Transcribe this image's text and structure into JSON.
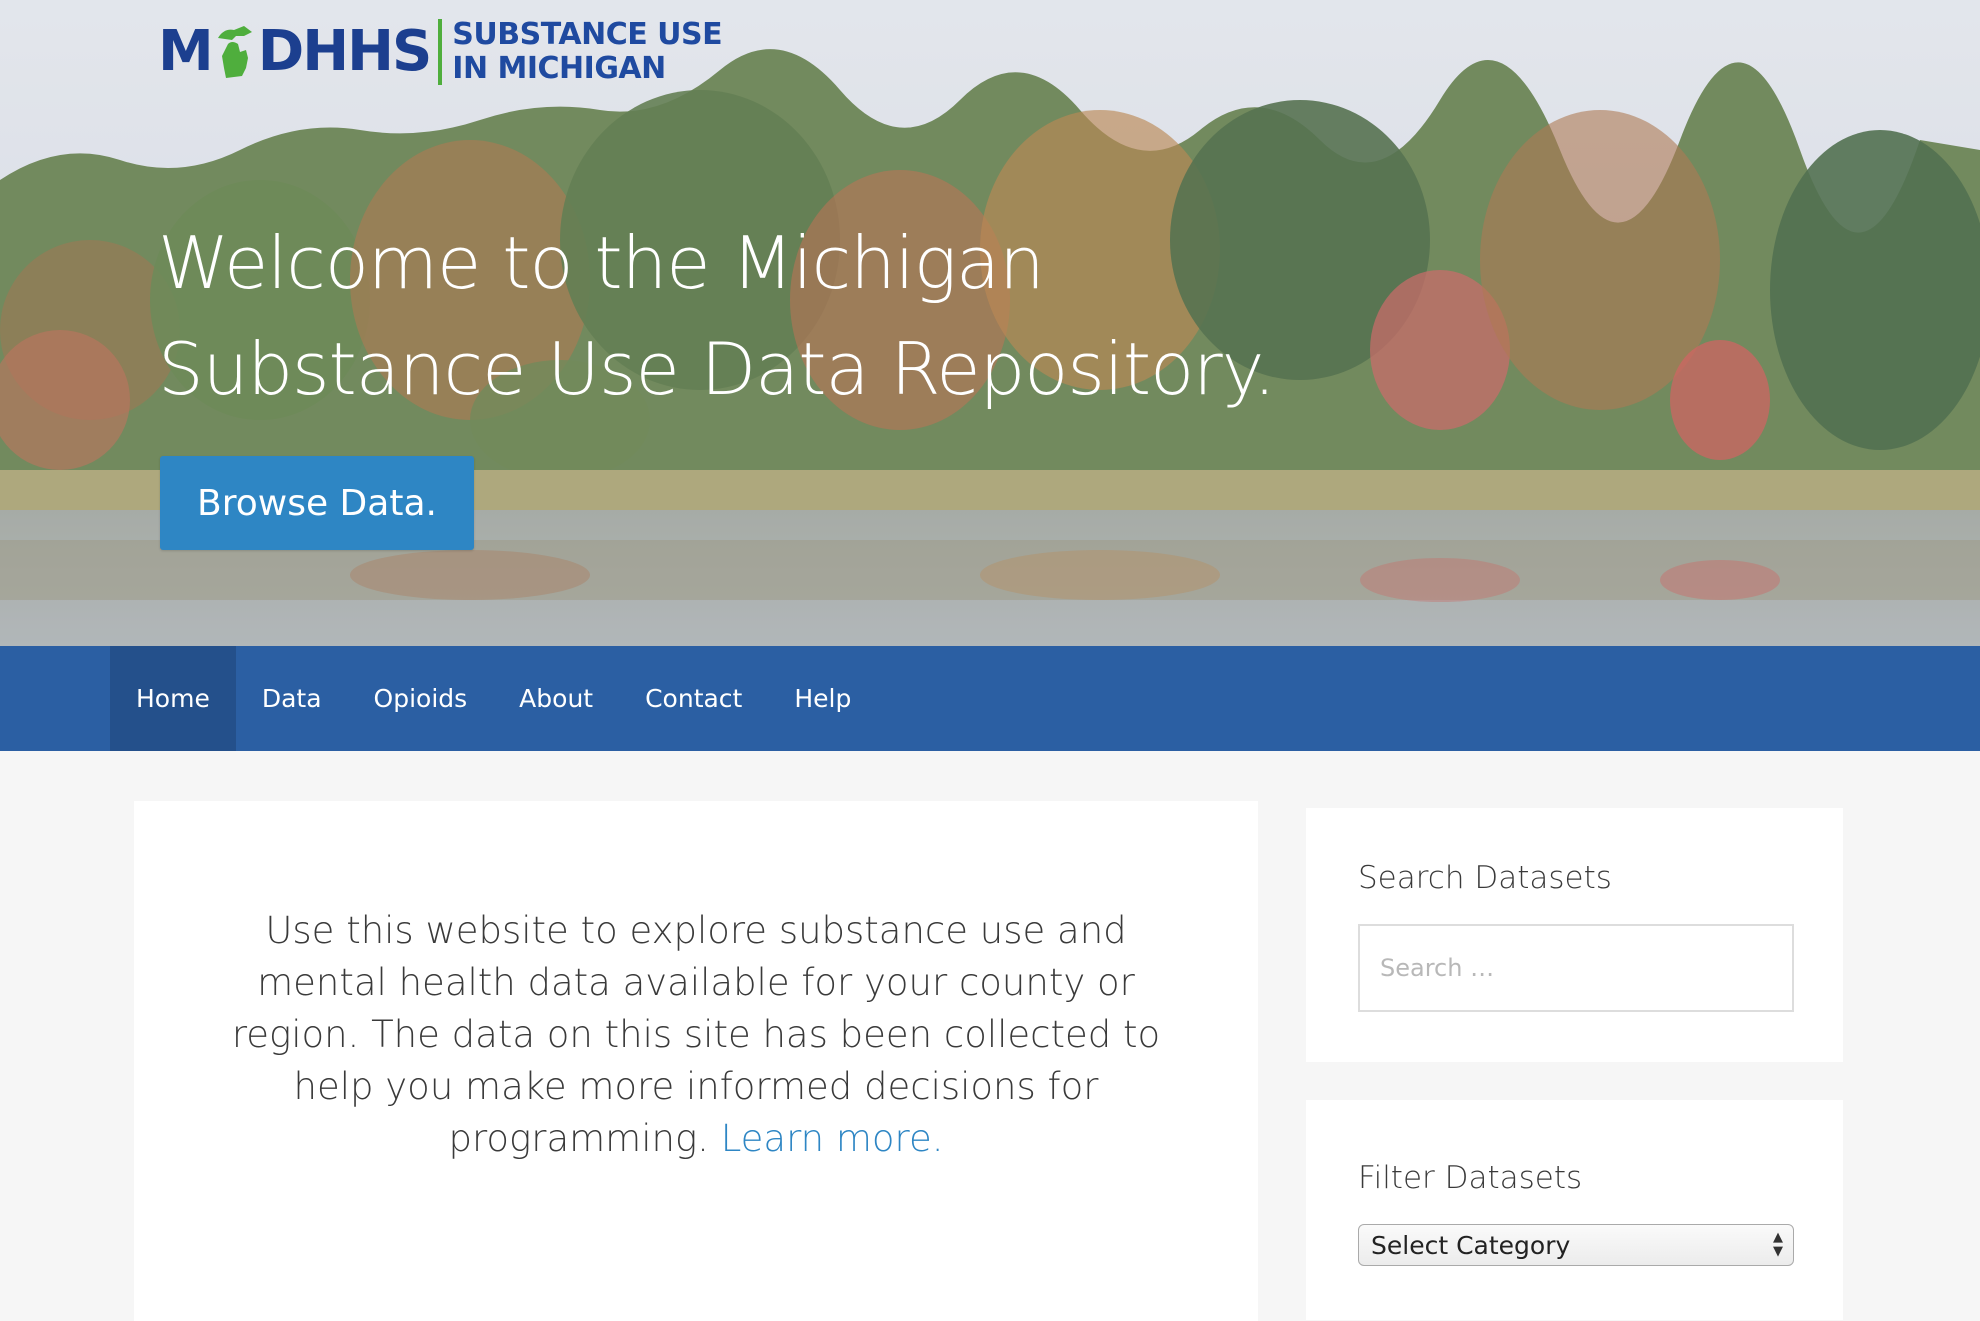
{
  "logo": {
    "wordmark_left": "M",
    "wordmark_right": "DHHS",
    "tagline_line1": "SUBSTANCE USE",
    "tagline_line2": "IN MICHIGAN"
  },
  "hero": {
    "title_line1": "Welcome to the Michigan",
    "title_line2": "Substance Use Data Repository.",
    "browse_label": "Browse Data."
  },
  "nav": {
    "items": [
      {
        "label": "Home",
        "active": true
      },
      {
        "label": "Data"
      },
      {
        "label": "Opioids"
      },
      {
        "label": "About"
      },
      {
        "label": "Contact"
      },
      {
        "label": "Help"
      }
    ]
  },
  "intro": {
    "text": "Use this website to explore substance use and mental health data available for your county or region. The data on this site has been collected to help you make more informed decisions for programming.",
    "link_text": "Learn more."
  },
  "sidebar": {
    "search_title": "Search Datasets",
    "search_placeholder": "Search …",
    "filter_title": "Filter Datasets",
    "filter_selected": "Select Category"
  },
  "colors": {
    "nav_bg": "#2b5fa3",
    "nav_active": "#24508b",
    "accent": "#2e86c4",
    "logo_blue": "#1c3f8f",
    "logo_green": "#4fae3d"
  }
}
